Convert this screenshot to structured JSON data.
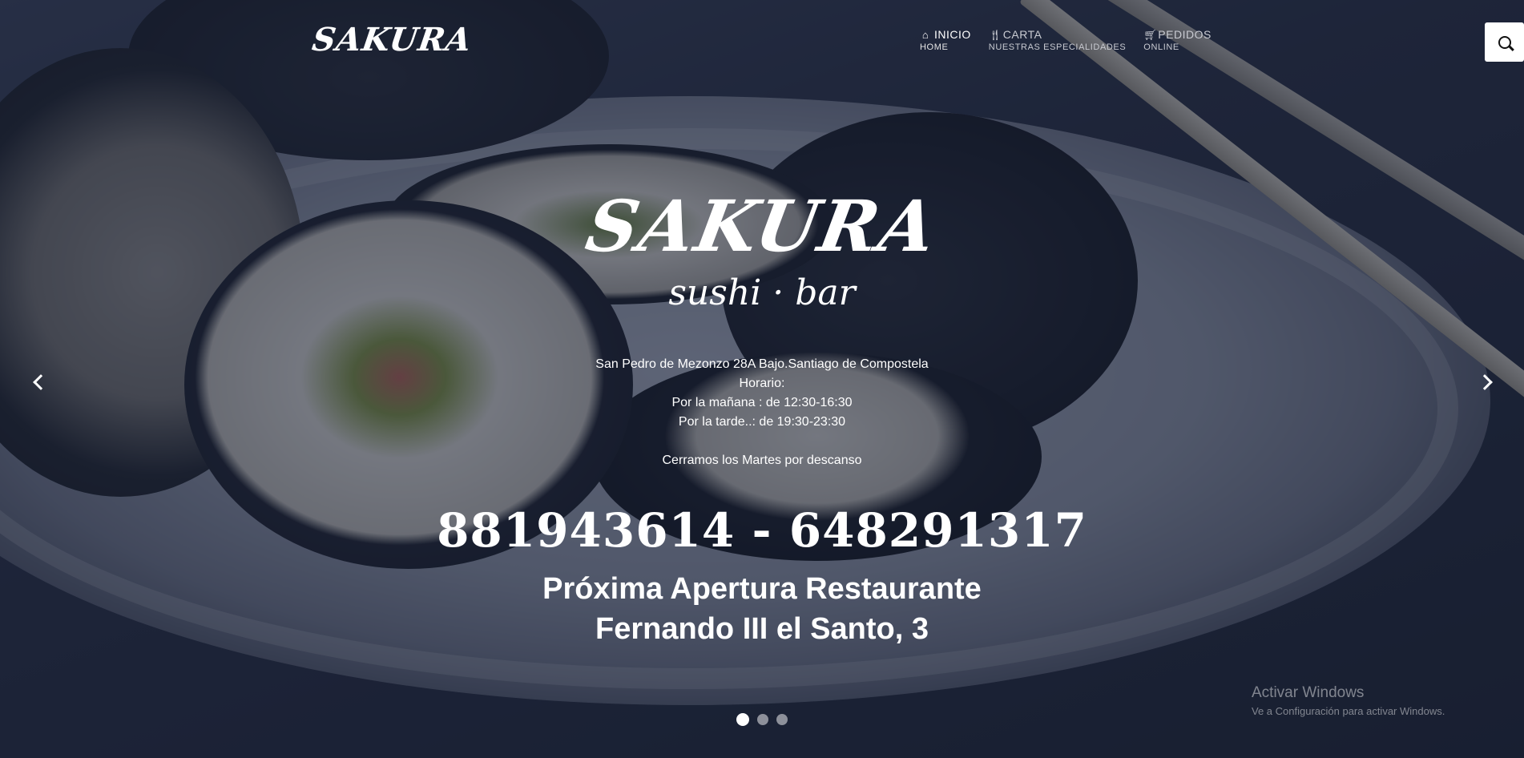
{
  "brand": {
    "name": "SAKURA"
  },
  "nav": {
    "items": [
      {
        "icon": "home-icon",
        "label": "INICIO",
        "sub": "HOME"
      },
      {
        "icon": "cutlery-icon",
        "label": "CARTA",
        "sub": "NUESTRAS ESPECIALIDADES"
      },
      {
        "icon": "cart-icon",
        "label": "PEDIDOS",
        "sub": "ONLINE"
      }
    ],
    "search_icon": "search-icon"
  },
  "hero": {
    "logo": "SAKURA",
    "tagline": "sushi · bar",
    "info": [
      "San Pedro de Mezonzo 28A Bajo.Santiago de Compostela",
      "Horario:",
      "Por la mañana : de 12:30-16:30",
      "Por la tarde..: de 19:30-23:30",
      "",
      "Cerramos los Martes por descanso"
    ],
    "phones": "881943614 - 648291317",
    "opening_line1": "Próxima Apertura Restaurante",
    "opening_line2": "Fernando III el Santo, 3"
  },
  "slider": {
    "slides": 3,
    "active": 1,
    "prev_icon": "chevron-left-icon",
    "next_icon": "chevron-right-icon"
  },
  "watermark": {
    "title": "Activar Windows",
    "subtitle": "Ve a Configuración para activar Windows."
  },
  "colors": {
    "overlay": "#141b30",
    "text": "#ffffff"
  }
}
